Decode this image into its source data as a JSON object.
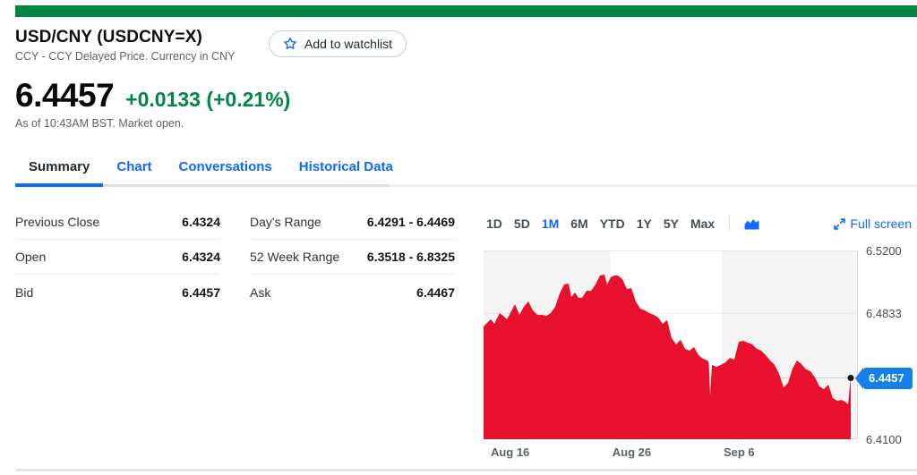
{
  "page": {
    "accent_green": "#008742",
    "link_blue": "#0f69ff"
  },
  "header": {
    "title": "USD/CNY (USDCNY=X)",
    "subtitle": "CCY - CCY Delayed Price. Currency in CNY",
    "watchlist_label": "Add to watchlist"
  },
  "quote": {
    "price": "6.4457",
    "change": "+0.0133 (+0.21%)",
    "change_color": "#008742",
    "as_of": "As of 10:43AM BST. Market open."
  },
  "tabs": [
    {
      "label": "Summary",
      "active": true
    },
    {
      "label": "Chart",
      "active": false
    },
    {
      "label": "Conversations",
      "active": false
    },
    {
      "label": "Historical Data",
      "active": false
    }
  ],
  "stats": {
    "left": [
      {
        "label": "Previous Close",
        "value": "6.4324"
      },
      {
        "label": "Open",
        "value": "6.4324"
      },
      {
        "label": "Bid",
        "value": "6.4457"
      }
    ],
    "right": [
      {
        "label": "Day's Range",
        "value": "6.4291 - 6.4469"
      },
      {
        "label": "52 Week Range",
        "value": "6.3518 - 6.8325"
      },
      {
        "label": "Ask",
        "value": "6.4467"
      }
    ]
  },
  "chart_controls": {
    "ranges": [
      "1D",
      "5D",
      "1M",
      "6M",
      "YTD",
      "1Y",
      "5Y",
      "Max"
    ],
    "active": "1M",
    "fullscreen_label": "Full screen"
  },
  "chart_data": {
    "type": "area",
    "period": "1M",
    "ylim": [
      6.41,
      6.52
    ],
    "yticks": [
      {
        "v": 6.52,
        "label": "6.5200"
      },
      {
        "v": 6.4833,
        "label": "6.4833"
      },
      {
        "v": 6.41,
        "label": "6.4100"
      }
    ],
    "xticks": [
      {
        "t": 0.019,
        "label": "Aug 16"
      },
      {
        "t": 0.344,
        "label": "Aug 26"
      },
      {
        "t": 0.641,
        "label": "Sep 6"
      }
    ],
    "band_bounds": [
      0,
      0.34,
      0.636,
      1
    ],
    "band_colors": [
      "#f4f4f5",
      "#ffffff",
      "#f4f4f5"
    ],
    "current": {
      "v": 6.4457,
      "label": "6.4457"
    },
    "area_color": "#e8112d",
    "badge_color": "#1580e8",
    "series": [
      [
        0.0,
        6.4757
      ],
      [
        0.0195,
        6.4799
      ],
      [
        0.0293,
        6.4773
      ],
      [
        0.0439,
        6.4835
      ],
      [
        0.0537,
        6.4819
      ],
      [
        0.0634,
        6.4799
      ],
      [
        0.0732,
        6.4835
      ],
      [
        0.0854,
        6.4887
      ],
      [
        0.0976,
        6.4825
      ],
      [
        0.1098,
        6.4872
      ],
      [
        0.122,
        6.4903
      ],
      [
        0.1341,
        6.4851
      ],
      [
        0.1463,
        6.4825
      ],
      [
        0.1585,
        6.4825
      ],
      [
        0.1707,
        6.4819
      ],
      [
        0.1829,
        6.4835
      ],
      [
        0.1951,
        6.4872
      ],
      [
        0.2073,
        6.495
      ],
      [
        0.2195,
        6.5002
      ],
      [
        0.2317,
        6.5007
      ],
      [
        0.239,
        6.4929
      ],
      [
        0.2488,
        6.4955
      ],
      [
        0.2585,
        6.4924
      ],
      [
        0.2683,
        6.4924
      ],
      [
        0.2805,
        6.4965
      ],
      [
        0.2927,
        6.4965
      ],
      [
        0.3049,
        6.5002
      ],
      [
        0.3171,
        6.5054
      ],
      [
        0.3293,
        6.5059
      ],
      [
        0.3366,
        6.5002
      ],
      [
        0.3463,
        6.5044
      ],
      [
        0.3561,
        6.5054
      ],
      [
        0.3659,
        6.5054
      ],
      [
        0.378,
        6.5033
      ],
      [
        0.3902,
        6.4976
      ],
      [
        0.4024,
        6.4981
      ],
      [
        0.4146,
        6.4903
      ],
      [
        0.4268,
        6.4861
      ],
      [
        0.439,
        6.4851
      ],
      [
        0.4512,
        6.4835
      ],
      [
        0.4634,
        6.4825
      ],
      [
        0.4756,
        6.4809
      ],
      [
        0.4878,
        6.4773
      ],
      [
        0.5,
        6.4794
      ],
      [
        0.5122,
        6.4689
      ],
      [
        0.5244,
        6.4653
      ],
      [
        0.5366,
        6.4679
      ],
      [
        0.5488,
        6.4627
      ],
      [
        0.561,
        6.4616
      ],
      [
        0.5732,
        6.4637
      ],
      [
        0.5854,
        6.459
      ],
      [
        0.5976,
        6.4569
      ],
      [
        0.6098,
        6.4559
      ],
      [
        0.6134,
        6.4548
      ],
      [
        0.6171,
        6.4355
      ],
      [
        0.622,
        6.4533
      ],
      [
        0.6341,
        6.4522
      ],
      [
        0.6463,
        6.4533
      ],
      [
        0.6585,
        6.4548
      ],
      [
        0.6707,
        6.4574
      ],
      [
        0.6829,
        6.4564
      ],
      [
        0.6951,
        6.4668
      ],
      [
        0.7073,
        6.4673
      ],
      [
        0.7195,
        6.4663
      ],
      [
        0.7317,
        6.4653
      ],
      [
        0.7439,
        6.4627
      ],
      [
        0.7561,
        6.4616
      ],
      [
        0.7683,
        6.459
      ],
      [
        0.7805,
        6.4559
      ],
      [
        0.7927,
        6.4533
      ],
      [
        0.8049,
        6.4481
      ],
      [
        0.8171,
        6.4402
      ],
      [
        0.8293,
        6.4428
      ],
      [
        0.8415,
        6.4512
      ],
      [
        0.8537,
        6.4559
      ],
      [
        0.8659,
        6.4538
      ],
      [
        0.878,
        6.4507
      ],
      [
        0.8902,
        6.4496
      ],
      [
        0.9024,
        6.446
      ],
      [
        0.9146,
        6.4408
      ],
      [
        0.9268,
        6.4392
      ],
      [
        0.939,
        6.4418
      ],
      [
        0.9512,
        6.434
      ],
      [
        0.9634,
        6.4324
      ],
      [
        0.9756,
        6.4329
      ],
      [
        0.9878,
        6.4314
      ],
      [
        0.9927,
        6.4303
      ],
      [
        1.0,
        6.4457
      ]
    ]
  }
}
